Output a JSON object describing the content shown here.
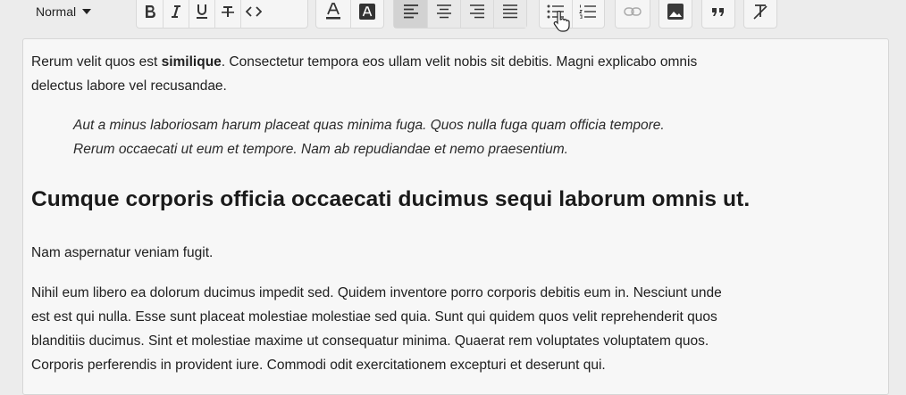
{
  "toolbar": {
    "heading_select": {
      "value": "Normal"
    },
    "buttons": [
      {
        "name": "bold",
        "icon": "bold-icon"
      },
      {
        "name": "italic",
        "icon": "italic-icon"
      },
      {
        "name": "underline",
        "icon": "underline-icon"
      },
      {
        "name": "strikethrough",
        "icon": "strikethrough-icon"
      },
      {
        "name": "code",
        "icon": "code-icon"
      },
      {
        "name": "text-color",
        "icon": "text-color-icon"
      },
      {
        "name": "background-color",
        "icon": "background-color-icon"
      },
      {
        "name": "align-left",
        "icon": "align-left-icon",
        "active": true
      },
      {
        "name": "align-center",
        "icon": "align-center-icon"
      },
      {
        "name": "align-right",
        "icon": "align-right-icon"
      },
      {
        "name": "align-justify",
        "icon": "align-justify-icon"
      },
      {
        "name": "bullet-list",
        "icon": "bullet-list-icon"
      },
      {
        "name": "numbered-list",
        "icon": "numbered-list-icon"
      },
      {
        "name": "link",
        "icon": "link-icon"
      },
      {
        "name": "image",
        "icon": "image-icon"
      },
      {
        "name": "blockquote",
        "icon": "quote-icon"
      },
      {
        "name": "clear-formatting",
        "icon": "clear-formatting-icon"
      }
    ]
  },
  "content": {
    "p1_before": "Rerum velit quos est ",
    "p1_bold": "similique",
    "p1_after_line1": ". Consectetur tempora eos ullam velit nobis sit debitis. Magni explicabo omnis",
    "p1_line2": "delectus labore vel recusandae.",
    "quote_line1": "Aut a minus laboriosam harum placeat quas minima fuga. Quos nulla fuga quam officia tempore.",
    "quote_line2": "Rerum occaecati ut eum et tempore. Nam ab repudiandae et nemo praesentium.",
    "heading": "Cumque corporis officia occaecati ducimus sequi laborum omnis ut.",
    "p2": "Nam aspernatur veniam fugit.",
    "p3_lines": [
      "Nihil eum libero ea dolorum ducimus impedit sed. Quidem inventore porro corporis debitis eum in. Nesciunt unde",
      "est est qui nulla. Esse sunt placeat molestiae molestiae sed quia. Sunt qui quidem quos velit reprehenderit quos",
      "blanditiis ducimus. Sint et molestiae maxime ut consequatur minima. Quaerat rem voluptates voluptatem quos.",
      "Corporis perferendis in provident iure. Commodi odit exercitationem excepturi et deserunt qui."
    ]
  }
}
